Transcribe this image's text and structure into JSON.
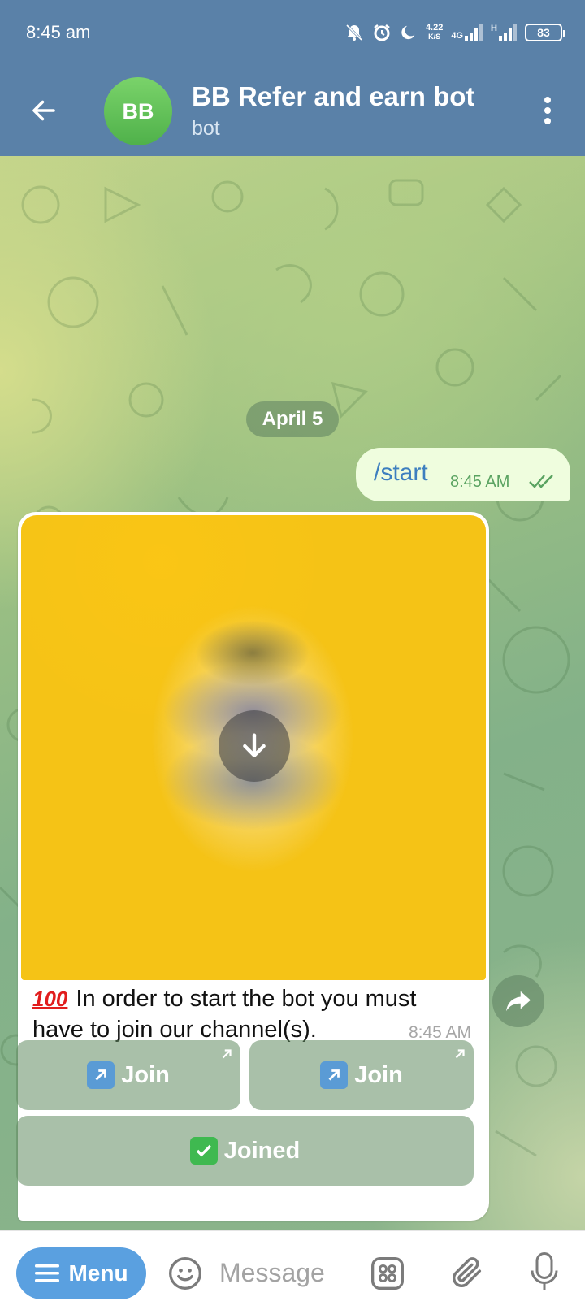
{
  "status_bar": {
    "time": "8:45 am",
    "net_speed_value": "4.22",
    "net_speed_unit": "K/S",
    "net_type": "4G",
    "net_type_2": "H",
    "battery": "83"
  },
  "header": {
    "avatar_initials": "BB",
    "title": "BB Refer and earn bot",
    "subtitle": "bot"
  },
  "chat": {
    "date_chip": "April 5",
    "outgoing": {
      "text": "/start",
      "time": "8:45 AM",
      "status": "read"
    },
    "incoming": {
      "emoji": "100",
      "text": "In order to start the bot you must have to join our channel(s).",
      "time": "8:45 AM"
    },
    "keyboard": {
      "join_1": "Join",
      "join_2": "Join",
      "joined": "Joined"
    }
  },
  "bottom": {
    "menu_label": "Menu",
    "message_placeholder": "Message"
  },
  "colors": {
    "header": "#5a81a8",
    "outgoing_bubble": "#effdde",
    "menu_button": "#5aa0e0",
    "photo_placeholder": "#f5c316"
  },
  "icons": [
    "back-arrow-icon",
    "more-vert-icon",
    "download-icon",
    "share-icon",
    "double-check-icon",
    "emoji-icon",
    "apps-icon",
    "attach-icon",
    "mic-icon",
    "menu-icon"
  ]
}
